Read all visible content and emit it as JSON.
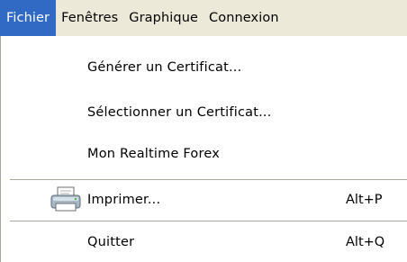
{
  "menubar": {
    "items": [
      {
        "label": "Fichier",
        "active": true
      },
      {
        "label": "Fenêtres",
        "active": false
      },
      {
        "label": "Graphique",
        "active": false
      },
      {
        "label": "Connexion",
        "active": false
      }
    ]
  },
  "dropdown": {
    "items": [
      {
        "label": "Générer un Certificat...",
        "shortcut": ""
      },
      {
        "label": "Sélectionner un Certificat...",
        "shortcut": ""
      },
      {
        "label": "Mon  Realtime Forex",
        "shortcut": ""
      },
      {
        "label": "Imprimer...",
        "shortcut": "Alt+P",
        "icon": "printer-icon"
      },
      {
        "label": "Quitter",
        "shortcut": "Alt+Q"
      }
    ]
  },
  "colors": {
    "menubar_bg": "#ece9d8",
    "highlight": "#316ac5",
    "separator": "#aca899"
  }
}
